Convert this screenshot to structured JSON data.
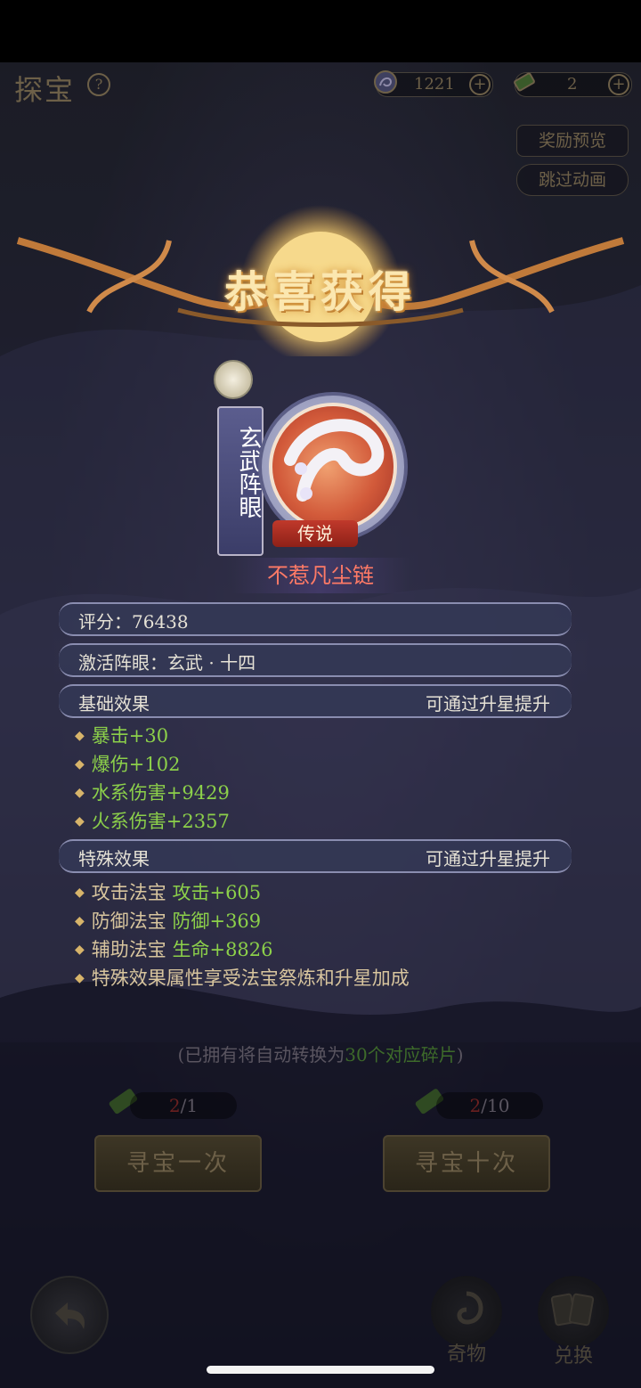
{
  "header": {
    "title": "探宝",
    "help_icon": "?",
    "currency1_value": "1221",
    "currency2_value": "2",
    "plus_symbol": "+"
  },
  "top_buttons": {
    "reward_preview": "奖励预览",
    "skip_animation": "跳过动画"
  },
  "banner": {
    "title": "恭喜获得"
  },
  "item": {
    "tag": "玄武阵眼",
    "rarity": "传说",
    "name": "不惹凡尘链"
  },
  "info": {
    "score_label": "评分：76438",
    "activate_label": "激活阵眼：玄武 · 十四",
    "basic_title": "基础效果",
    "basic_hint": "可通过升星提升",
    "special_title": "特殊效果",
    "special_hint": "可通过升星提升"
  },
  "basic_stats": [
    "暴击+30",
    "爆伤+102",
    "水系伤害+9429",
    "火系伤害+2357"
  ],
  "special_stats": [
    {
      "prefix": "攻击法宝",
      "value": "攻击+605"
    },
    {
      "prefix": "防御法宝",
      "value": "防御+369"
    },
    {
      "prefix": "辅助法宝",
      "value": "生命+8826"
    }
  ],
  "special_note": "特殊效果属性享受法宝祭炼和升星加成",
  "bottom": {
    "note_start": "(已拥有将自动转换为",
    "note_green": "30个对应碎片",
    "note_end": ")",
    "counter1_current": "2",
    "counter1_total": "/1",
    "counter2_current": "2",
    "counter2_total": "/10",
    "search_once": "寻宝一次",
    "search_ten": "寻宝十次",
    "oddities": "奇物",
    "exchange": "兑换"
  },
  "colors": {
    "stat_green": "#8cd04a",
    "name_red": "#ff7a66",
    "banner_gold": "#fbe7b0"
  }
}
